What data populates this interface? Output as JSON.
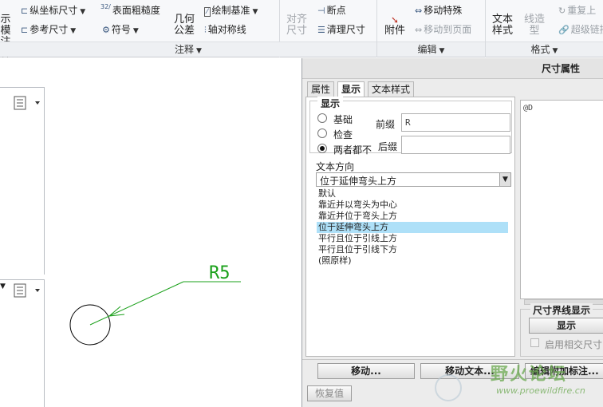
{
  "ribbon": {
    "model_label_1": "示模",
    "model_label_2": "注释",
    "ordinate_dim": "纵坐标尺寸",
    "ref_dim": "参考尺寸",
    "surface_finish": "表面粗糙度",
    "symbol": "符号",
    "geo_tol_1": "几何",
    "geo_tol_2": "公差",
    "datum_feature": "绘制基准",
    "axis_sym": "轴对称线",
    "align_dim_1": "对齐",
    "align_dim_2": "尺寸",
    "breakpoint": "断点",
    "cleanup_dim": "清理尺寸",
    "attach": "附件",
    "move_special": "移动特殊",
    "move_to_page": "移动到页面",
    "text_style_1": "文本",
    "text_style_2": "样式",
    "line_style_1": "线造",
    "line_style_2": "型",
    "repeat_last": "重复上",
    "hyperlink": "超级链接",
    "group_annotation": "注释",
    "group_edit": "编辑",
    "group_format": "格式",
    "surface_finish_sup": "32/"
  },
  "drawing": {
    "dimension_text": "R5"
  },
  "panel": {
    "title": "尺寸属性",
    "tabs": [
      "属性",
      "显示",
      "文本样式"
    ],
    "display_group": "显示",
    "radio_basic": "基础",
    "radio_inspect": "检查",
    "radio_neither": "两者都不",
    "prefix_label": "前缀",
    "prefix_value": "R",
    "suffix_label": "后缀",
    "suffix_value": "",
    "text_dir_label": "文本方向",
    "text_dir_selected": "位于延伸弯头上方",
    "text_dir_options": [
      "默认",
      "靠近并以弯头为中心",
      "靠近并位于弯头上方",
      "位于延伸弯头上方",
      "平行且位于引线上方",
      "平行且位于引线下方",
      "(照原样)"
    ],
    "symbol_text": "@D",
    "witness_group": "尺寸界线显示",
    "witness_show_btn": "显示",
    "enable_cross": "启用相交尺寸",
    "move_btn": "移动...",
    "move_text_btn": "移动文本...",
    "edit_attach_btn": "编辑附加标注...",
    "restore_btn": "恢复值"
  },
  "watermark": {
    "title": "野火论坛",
    "url": "www.proewildfire.cn"
  },
  "colors": {
    "dimension": "#1aa01a",
    "selection": "#aee0f8"
  }
}
